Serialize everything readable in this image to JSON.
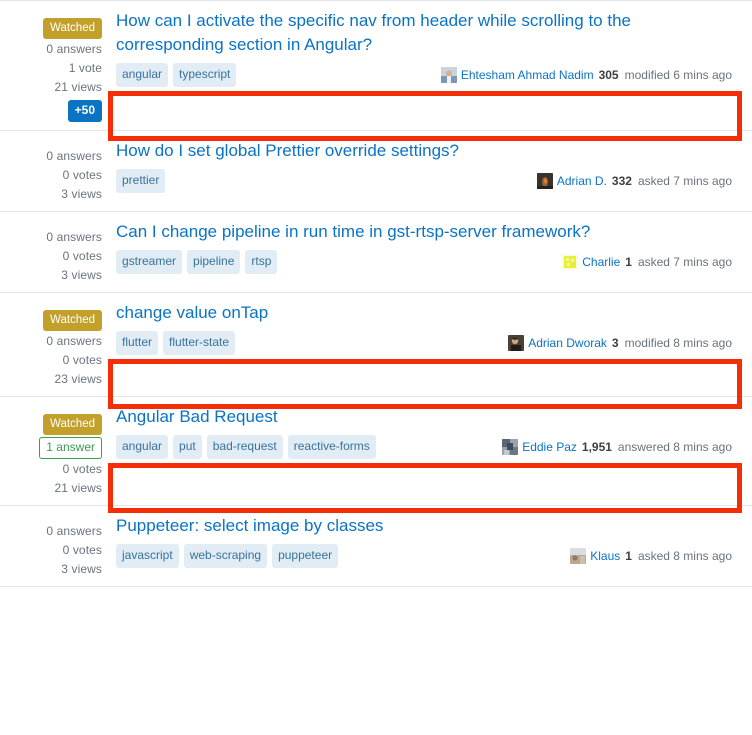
{
  "accent": {
    "link_blue": "#0a73c4",
    "tag_bg": "#e1ecf4",
    "tag_fg": "#39739d",
    "watched_bg": "#c2a02a",
    "answered_green": "#3a9c50",
    "bounty_bg": "#0a73c4",
    "highlight_red": "#f42f08",
    "muted_text": "#6a737c"
  },
  "questions": [
    {
      "watched_label": "Watched",
      "answers": "0 answers",
      "votes": "1 vote",
      "views": "21 views",
      "bounty": "+50",
      "title": "How can I activate the specific nav from header while scrolling to the corresponding section in Angular?",
      "tags": [
        "angular",
        "typescript"
      ],
      "user": {
        "name": "Ehtesham Ahmad Nadim",
        "rep": "305",
        "action": "modified 6 mins ago",
        "avatar": "avatar-person-blue-shirt"
      },
      "highlighted": true
    },
    {
      "watched_label": null,
      "answers": "0 answers",
      "votes": "0 votes",
      "views": "3 views",
      "bounty": null,
      "title": "How do I set global Prettier override settings?",
      "tags": [
        "prettier"
      ],
      "user": {
        "name": "Adrian D.",
        "rep": "332",
        "action": "asked 7 mins ago",
        "avatar": "avatar-dark-flame"
      },
      "highlighted": false
    },
    {
      "watched_label": null,
      "answers": "0 answers",
      "votes": "0 votes",
      "views": "3 views",
      "bounty": null,
      "title": "Can I change pipeline in run time in gst-rtsp-server framework?",
      "tags": [
        "gstreamer",
        "pipeline",
        "rtsp"
      ],
      "user": {
        "name": "Charlie",
        "rep": "1",
        "action": "asked 7 mins ago",
        "avatar": "avatar-yellow-pattern"
      },
      "highlighted": false
    },
    {
      "watched_label": "Watched",
      "answers": "0 answers",
      "votes": "0 votes",
      "views": "23 views",
      "bounty": null,
      "title": "change value onTap",
      "tags": [
        "flutter",
        "flutter-state"
      ],
      "user": {
        "name": "Adrian Dworak",
        "rep": "3",
        "action": "modified 8 mins ago",
        "avatar": "avatar-dark-portrait"
      },
      "highlighted": true
    },
    {
      "watched_label": "Watched",
      "answered_label": "1 answer",
      "answers": null,
      "votes": "0 votes",
      "views": "21 views",
      "bounty": null,
      "title": "Angular Bad Request",
      "tags": [
        "angular",
        "put",
        "bad-request",
        "reactive-forms"
      ],
      "user": {
        "name": "Eddie Paz",
        "rep": "1,951",
        "action": "answered 8 mins ago",
        "avatar": "avatar-blue-grey-noise"
      },
      "highlighted": true
    },
    {
      "watched_label": null,
      "answers": "0 answers",
      "votes": "0 votes",
      "views": "3 views",
      "bounty": null,
      "title": "Puppeteer: select image by classes",
      "tags": [
        "javascript",
        "web-scraping",
        "puppeteer"
      ],
      "user": {
        "name": "Klaus",
        "rep": "1",
        "action": "asked 8 mins ago",
        "avatar": "avatar-light-scene"
      },
      "highlighted": false
    }
  ]
}
